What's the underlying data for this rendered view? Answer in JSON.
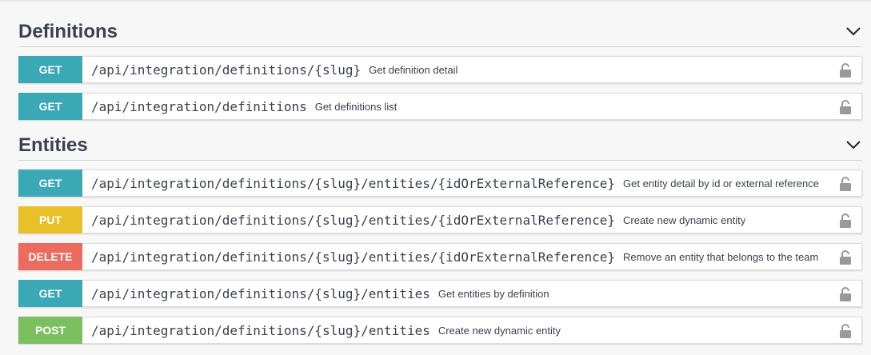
{
  "sections": [
    {
      "title": "Definitions",
      "operations": [
        {
          "method": "GET",
          "color": "#3aa9b5",
          "path": "/api/integration/definitions/{slug}",
          "summary": "Get definition detail"
        },
        {
          "method": "GET",
          "color": "#3aa9b5",
          "path": "/api/integration/definitions",
          "summary": "Get definitions list"
        }
      ]
    },
    {
      "title": "Entities",
      "operations": [
        {
          "method": "GET",
          "color": "#3aa9b5",
          "path": "/api/integration/definitions/{slug}/entities/{idOrExternalReference}",
          "summary": "Get entity detail by id or external reference"
        },
        {
          "method": "PUT",
          "color": "#e8c12a",
          "path": "/api/integration/definitions/{slug}/entities/{idOrExternalReference}",
          "summary": "Create new dynamic entity"
        },
        {
          "method": "DELETE",
          "color": "#ec6b5f",
          "path": "/api/integration/definitions/{slug}/entities/{idOrExternalReference}",
          "summary": "Remove an entity that belongs to the team"
        },
        {
          "method": "GET",
          "color": "#3aa9b5",
          "path": "/api/integration/definitions/{slug}/entities",
          "summary": "Get entities by definition"
        },
        {
          "method": "POST",
          "color": "#7cbf5e",
          "path": "/api/integration/definitions/{slug}/entities",
          "summary": "Create new dynamic entity"
        }
      ]
    }
  ],
  "icons": {
    "collapse": "chevron-down-icon",
    "auth": "lock-icon"
  }
}
